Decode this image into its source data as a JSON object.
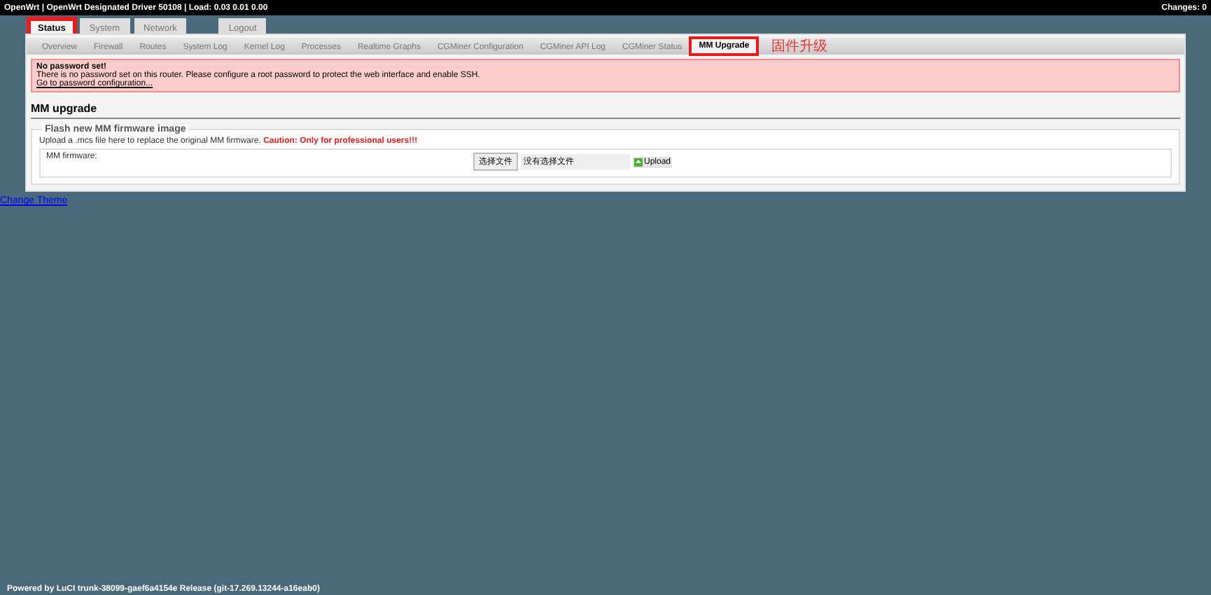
{
  "header": {
    "title": "OpenWrt | OpenWrt Designated Driver 50108 | Load: 0.03 0.01 0.00",
    "changes": "Changes: 0"
  },
  "main_tabs": [
    {
      "label": "Status",
      "selected": true,
      "highlighted": true
    },
    {
      "label": "System",
      "selected": false,
      "highlighted": false
    },
    {
      "label": "Network",
      "selected": false,
      "highlighted": false
    },
    {
      "label": "Logout",
      "selected": false,
      "highlighted": false
    }
  ],
  "sub_tabs": [
    {
      "label": "Overview",
      "selected": false,
      "highlighted": false
    },
    {
      "label": "Firewall",
      "selected": false,
      "highlighted": false
    },
    {
      "label": "Routes",
      "selected": false,
      "highlighted": false
    },
    {
      "label": "System Log",
      "selected": false,
      "highlighted": false
    },
    {
      "label": "Kernel Log",
      "selected": false,
      "highlighted": false
    },
    {
      "label": "Processes",
      "selected": false,
      "highlighted": false
    },
    {
      "label": "Realtime Graphs",
      "selected": false,
      "highlighted": false
    },
    {
      "label": "CGMiner Configuration",
      "selected": false,
      "highlighted": false
    },
    {
      "label": "CGMiner API Log",
      "selected": false,
      "highlighted": false
    },
    {
      "label": "CGMiner Status",
      "selected": false,
      "highlighted": false
    },
    {
      "label": "MM Upgrade",
      "selected": true,
      "highlighted": true
    }
  ],
  "annotation": "固件升级",
  "alert": {
    "title": "No password set!",
    "text": "There is no password set on this router. Please configure a root password to protect the web interface and enable SSH.",
    "link": "Go to password configuration..."
  },
  "section_title": "MM upgrade",
  "fieldset": {
    "legend": "Flash new MM firmware image",
    "description": "Upload a .mcs file here to replace the original MM firmware. **Caution: Only for professional users!!!**",
    "field_label": "MM firmware:",
    "choose_button": "选择文件",
    "file_status": "没有选择文件",
    "upload_button": "Upload"
  },
  "change_theme": "Change Theme",
  "footer": "Powered by LuCI trunk-38099-gaef6a4154e Release (git-17.269.13244-a16eab0)"
}
